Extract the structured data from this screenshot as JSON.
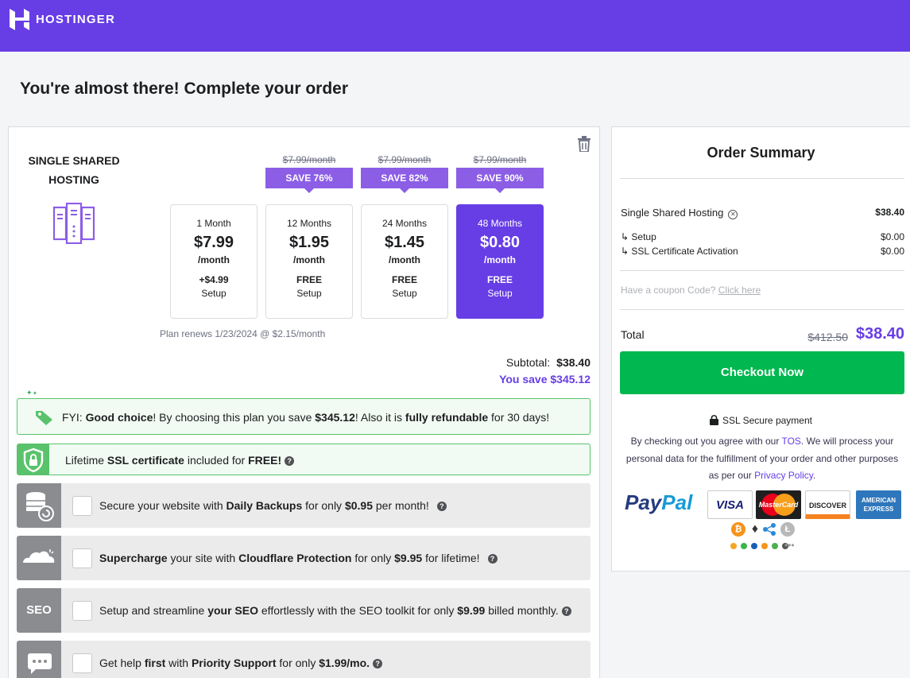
{
  "brand": {
    "name": "HOSTINGER",
    "color": "#673de6"
  },
  "page_title": "You're almost there! Complete your order",
  "plan": {
    "name_line1": "SINGLE SHARED",
    "name_line2": "HOSTING",
    "icon": "server-icon",
    "periods": [
      {
        "months": "1 Month",
        "price": "$7.99",
        "per": "/month",
        "setup_fee": "+$4.99",
        "setup_label": "Setup",
        "old_price": "",
        "save": ""
      },
      {
        "months": "12 Months",
        "price": "$1.95",
        "per": "/month",
        "setup_fee": "FREE",
        "setup_label": "Setup",
        "old_price": "$7.99/month",
        "save": "SAVE 76%"
      },
      {
        "months": "24 Months",
        "price": "$1.45",
        "per": "/month",
        "setup_fee": "FREE",
        "setup_label": "Setup",
        "old_price": "$7.99/month",
        "save": "SAVE 82%"
      },
      {
        "months": "48 Months",
        "price": "$0.80",
        "per": "/month",
        "setup_fee": "FREE",
        "setup_label": "Setup",
        "old_price": "$7.99/month",
        "save": "SAVE 90%"
      }
    ],
    "selected_period": "48 Months",
    "renews": "Plan renews 1/23/2024 @ $2.15/month"
  },
  "totals": {
    "subtotal_label": "Subtotal:",
    "subtotal_value": "$38.40",
    "you_save": "You save $345.12"
  },
  "fyi": {
    "p1": "FYI: ",
    "b1": "Good choice",
    "p2": "! By choosing this plan you save ",
    "b2": "$345.12",
    "p3": "! Also it is ",
    "b3": "fully refundable",
    "p4": " for 30 days!"
  },
  "ssl_banner": {
    "p1": "Lifetime ",
    "b1": "SSL certificate",
    "p2": " included for ",
    "b2": "FREE!"
  },
  "addons": [
    {
      "icon": "database-backup-icon",
      "parts": [
        {
          "t": "Secure your website with ",
          "b": false
        },
        {
          "t": "Daily Backups",
          "b": true
        },
        {
          "t": " for only ",
          "b": false
        },
        {
          "t": "$0.95",
          "b": true
        },
        {
          "t": " per month!",
          "b": false
        }
      ]
    },
    {
      "icon": "cloud-icon",
      "parts": [
        {
          "t": "Supercharge",
          "b": true
        },
        {
          "t": " your site with ",
          "b": false
        },
        {
          "t": "Cloudflare Protection",
          "b": true
        },
        {
          "t": " for only ",
          "b": false
        },
        {
          "t": "$9.95",
          "b": true
        },
        {
          "t": " for lifetime!",
          "b": false
        }
      ]
    },
    {
      "icon": "seo-icon",
      "icon_text": "SEO",
      "parts": [
        {
          "t": "Setup and streamline ",
          "b": false
        },
        {
          "t": "your SEO",
          "b": true
        },
        {
          "t": " effortlessly with the SEO toolkit for only ",
          "b": false
        },
        {
          "t": "$9.99",
          "b": true
        },
        {
          "t": " billed monthly.",
          "b": false
        }
      ]
    },
    {
      "icon": "chat-support-icon",
      "parts": [
        {
          "t": "Get help ",
          "b": false
        },
        {
          "t": "first",
          "b": true
        },
        {
          "t": " with ",
          "b": false
        },
        {
          "t": "Priority Support",
          "b": true
        },
        {
          "t": " for only ",
          "b": false
        },
        {
          "t": "$1.99/mo.",
          "b": true
        }
      ]
    }
  ],
  "summary": {
    "title": "Order Summary",
    "item_name": "Single Shared Hosting",
    "item_price": "$38.40",
    "sub_items": [
      {
        "label": "↳ Setup",
        "price": "$0.00"
      },
      {
        "label": "↳ SSL Certificate Activation",
        "price": "$0.00"
      }
    ],
    "coupon_text": "Have a coupon Code?",
    "coupon_link": "Click here",
    "total_label": "Total",
    "total_old": "$412.50",
    "total_new": "$38.40",
    "checkout_label": "Checkout Now",
    "secure_label": "SSL Secure payment",
    "agree_p1": "By checking out you agree with our ",
    "agree_tos": "TOS",
    "agree_p2": ". We will process your personal data for the fulfillment of your order and other purposes as per our ",
    "agree_privacy": "Privacy Policy",
    "agree_p3": "."
  },
  "payments": {
    "paypal_a": "Pay",
    "paypal_b": "Pal",
    "cards": [
      "VISA",
      "MasterCard",
      "DISCOVER",
      "AMERICAN EXPRESS"
    ],
    "crypto": [
      "bitcoin-icon",
      "ethereum-icon",
      "ripple-icon",
      "litecoin-icon"
    ]
  }
}
